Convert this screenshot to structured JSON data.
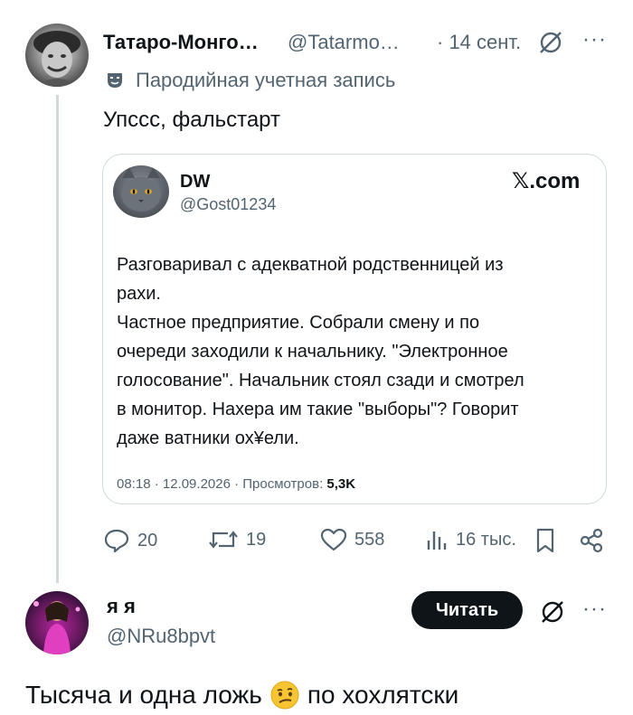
{
  "post": {
    "author_name": "Татаро-Монго…",
    "author_handle": "@Tatarmo…",
    "date": "· 14 сент.",
    "parody_label": "Пародийная учетная запись",
    "text": "Упссс, фальстарт"
  },
  "quoted": {
    "name": "DW",
    "handle": "@Gost01234",
    "source": "𝕏.com",
    "lines": [
      "Разговаривал с адекватной родственницей из",
      "рахи.",
      "Частное предприятие. Собрали смену и по",
      "очереди заходили к начальнику. \"Электронное",
      "голосование\". Начальник стоял сзади и смотрел",
      "в монитор. Нахера им такие \"выборы\"? Говорит",
      "даже ватники ох¥ели."
    ],
    "meta_text": "08:18 · 12.09.2026 · Просмотров: ",
    "views": "5,3K"
  },
  "actions": {
    "replies": "20",
    "reposts": "19",
    "likes": "558",
    "views": "16 тыс."
  },
  "reply": {
    "author_name": "я я",
    "author_handle": "@NRu8bpvt",
    "follow_label": "Читать",
    "text": "Тысяча и одна ложь",
    "text_suffix": "по хохлятски"
  },
  "more_glyph": "···",
  "icons": [
    "grok-icon",
    "more-icon",
    "theater-masks-icon",
    "reply-icon",
    "repost-icon",
    "like-icon",
    "views-icon",
    "bookmark-icon",
    "share-icon",
    "emoji-face-icon"
  ]
}
